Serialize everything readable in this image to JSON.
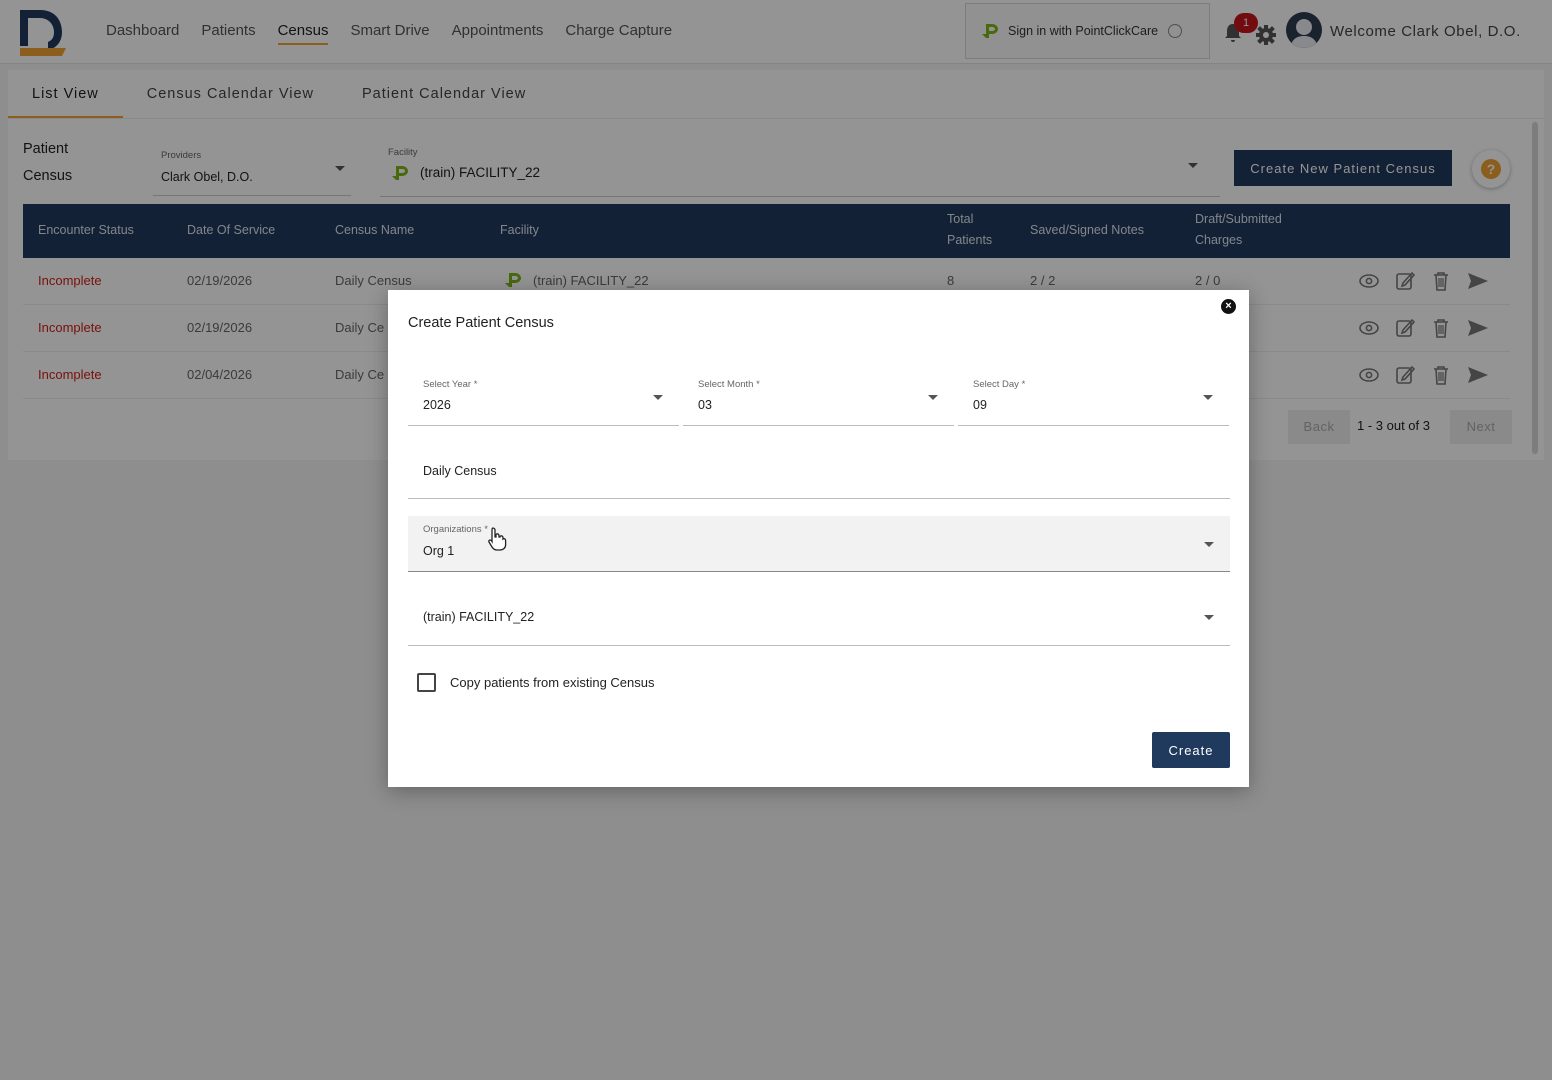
{
  "topbar": {
    "nav": [
      "Dashboard",
      "Patients",
      "Census",
      "Smart Drive",
      "Appointments",
      "Charge Capture"
    ],
    "active_nav": "Census",
    "pcc_label": "Sign in with PointClickCare",
    "notification_count": "1",
    "welcome": "Welcome Clark Obel, D.O."
  },
  "tabs": [
    "List View",
    "Census Calendar View",
    "Patient Calendar View"
  ],
  "filters": {
    "title_line1": "Patient",
    "title_line2": "Census",
    "providers_label": "Providers",
    "providers_value": "Clark Obel, D.O.",
    "facility_label": "Facility",
    "facility_value": "(train) FACILITY_22",
    "create_button": "Create New Patient Census"
  },
  "table": {
    "headers": {
      "status": "Encounter Status",
      "date": "Date Of Service",
      "name": "Census Name",
      "facility": "Facility",
      "total_1": "Total",
      "total_2": "Patients",
      "notes": "Saved/Signed Notes",
      "charges_1": "Draft/Submitted",
      "charges_2": "Charges"
    },
    "rows": [
      {
        "status": "Incomplete",
        "date": "02/19/2026",
        "name": "Daily Census",
        "facility": "(train) FACILITY_22",
        "total": "8",
        "notes": "2 / 2",
        "charges": "2 / 0"
      },
      {
        "status": "Incomplete",
        "date": "02/19/2026",
        "name": "Daily Ce"
      },
      {
        "status": "Incomplete",
        "date": "02/04/2026",
        "name": "Daily Ce"
      }
    ],
    "pager": {
      "back": "Back",
      "range": "1 - 3 out of 3",
      "next": "Next"
    }
  },
  "modal": {
    "title": "Create Patient Census",
    "year_label": "Select Year *",
    "year_value": "2026",
    "month_label": "Select Month *",
    "month_value": "03",
    "day_label": "Select Day *",
    "day_value": "09",
    "census_name": "Daily Census",
    "org_label": "Organizations *",
    "org_value": "Org 1",
    "facility_value": "(train) FACILITY_22",
    "copy_label": "Copy patients from existing Census",
    "create_button": "Create"
  },
  "colors": {
    "navy": "#1f3a5c",
    "accent": "#f0a232",
    "status_red": "#d0201a",
    "pcc_green": "#7cb518"
  }
}
